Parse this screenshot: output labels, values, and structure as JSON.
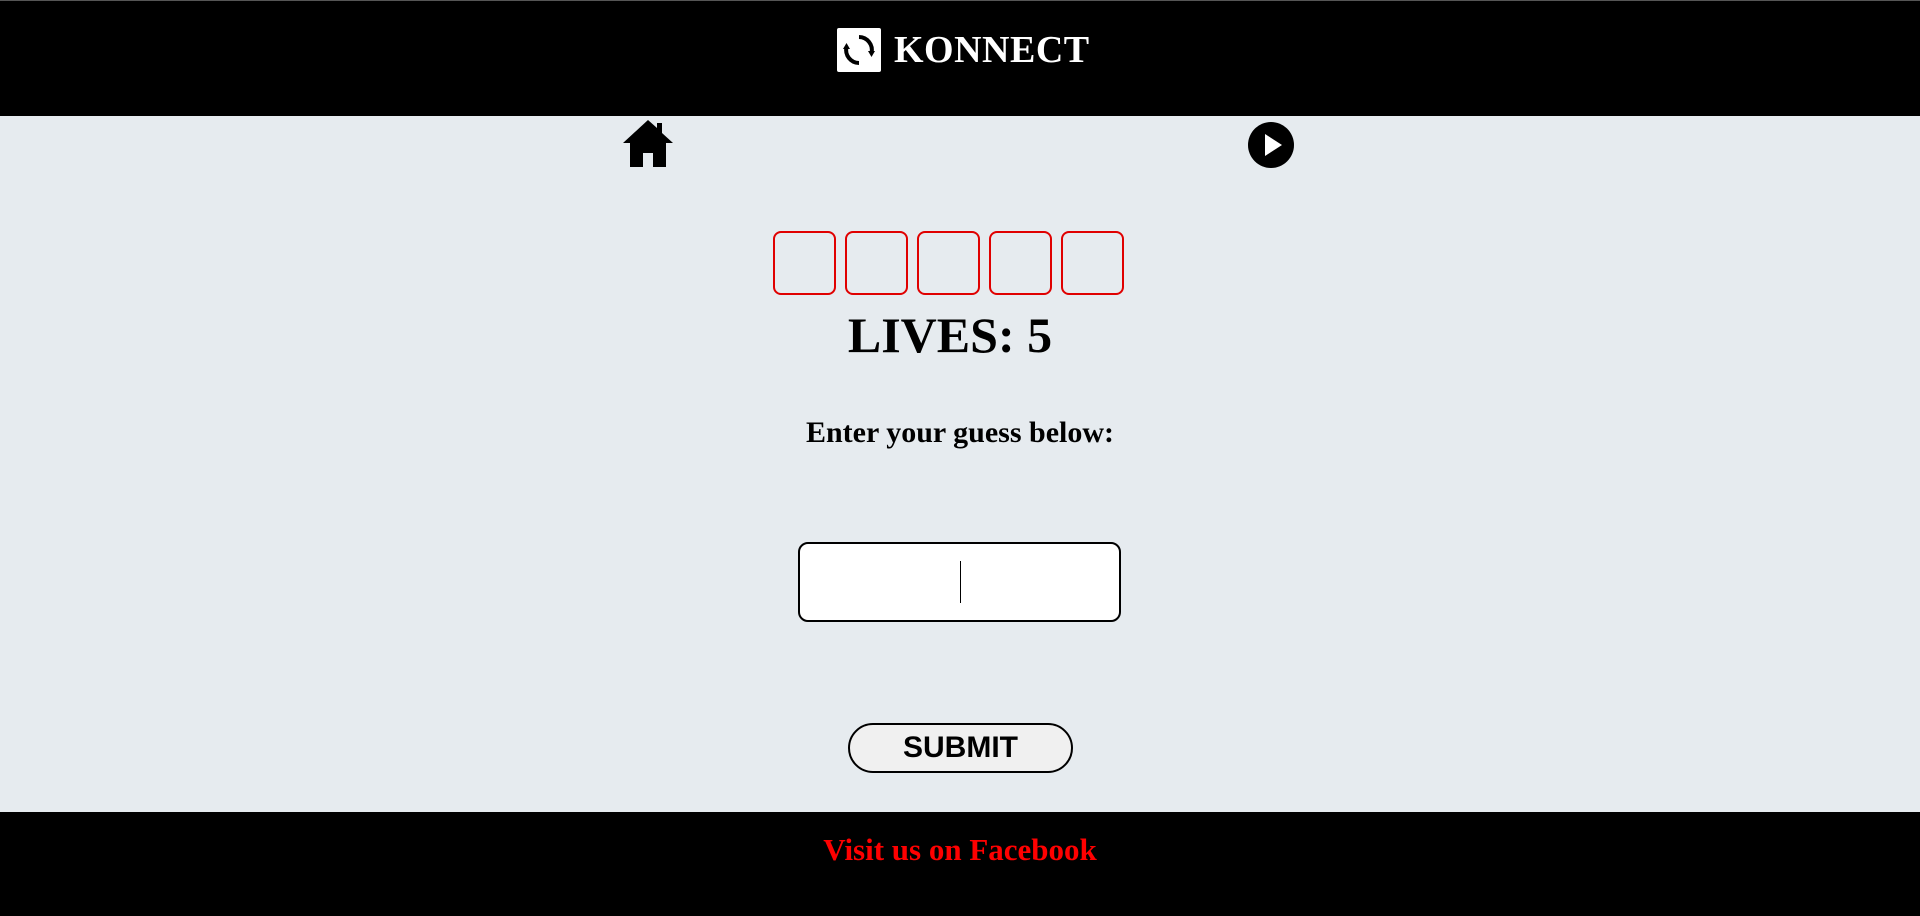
{
  "header": {
    "brand_name": "KONNECT",
    "logo_icon": "refresh-cycle-icon"
  },
  "nav": {
    "home_icon": "home-icon",
    "play_icon": "play-circle-icon"
  },
  "game": {
    "letter_tiles": [
      "",
      "",
      "",
      "",
      ""
    ],
    "tile_border_color": "#e00000",
    "lives_text": "LIVES: 5",
    "prompt": "Enter your guess below:",
    "guess_value": "",
    "submit_label": "SUBMIT"
  },
  "footer": {
    "link_text": "Visit us on Facebook",
    "link_color": "#ff0000"
  },
  "colors": {
    "page_background": "#e6ebef",
    "bar_background": "#000000"
  }
}
